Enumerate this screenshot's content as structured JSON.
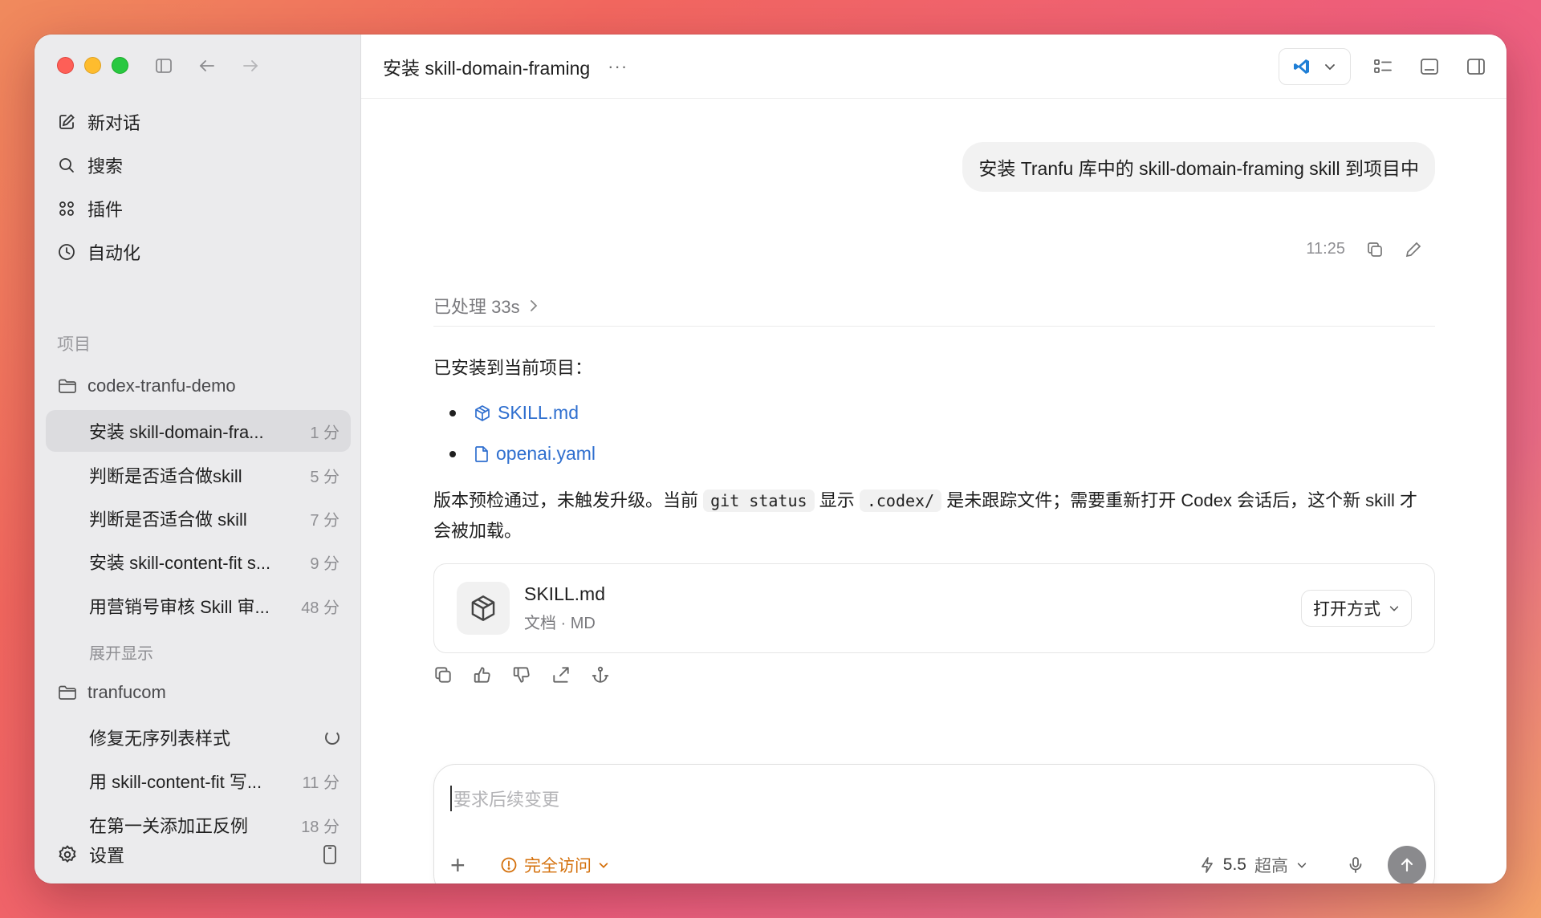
{
  "sidebar": {
    "nav": [
      {
        "label": "新对话",
        "icon": "edit-icon"
      },
      {
        "label": "搜索",
        "icon": "search-icon"
      },
      {
        "label": "插件",
        "icon": "grid-icon"
      },
      {
        "label": "自动化",
        "icon": "clock-icon"
      }
    ],
    "section_label": "项目",
    "projects": [
      {
        "name": "codex-tranfu-demo",
        "threads": [
          {
            "title": "安装 skill-domain-fra...",
            "time": "1 分"
          },
          {
            "title": "判断是否适合做skill",
            "time": "5 分"
          },
          {
            "title": "判断是否适合做 skill",
            "time": "7 分"
          },
          {
            "title": "安装 skill-content-fit s...",
            "time": "9 分"
          },
          {
            "title": "用营销号审核 Skill 审...",
            "time": "48 分"
          }
        ],
        "show_more": "展开显示"
      },
      {
        "name": "tranfucom",
        "threads": [
          {
            "title": "修复无序列表样式",
            "time": ""
          },
          {
            "title": "用 skill-content-fit 写...",
            "time": "11 分"
          },
          {
            "title": "在第一关添加正反例",
            "time": "18 分"
          }
        ]
      }
    ],
    "settings_label": "设置"
  },
  "header": {
    "title": "安装 skill-domain-framing",
    "more": "···"
  },
  "conversation": {
    "user_message": "安装 Tranfu 库中的 skill-domain-framing skill 到项目中",
    "user_time": "11:25",
    "processed": "已处理 33s",
    "intro": "已安装到当前项目：",
    "files": [
      "SKILL.md",
      "openai.yaml"
    ],
    "para_1": "版本预检通过，未触发升级。当前",
    "code_1": "git status",
    "para_2": "显示",
    "code_2": ".codex/",
    "para_3": "是未跟踪文件；需要重新打开 Codex 会话后，这个新 skill 才会被加载。",
    "card": {
      "name": "SKILL.md",
      "sub": "文档 · MD",
      "open_label": "打开方式"
    }
  },
  "composer": {
    "placeholder": "要求后续变更",
    "access_label": "完全访问",
    "model_version": "5.5",
    "model_level": "超高"
  },
  "colors": {
    "accent_link": "#2f6fcf",
    "access_warning": "#d4700b"
  }
}
